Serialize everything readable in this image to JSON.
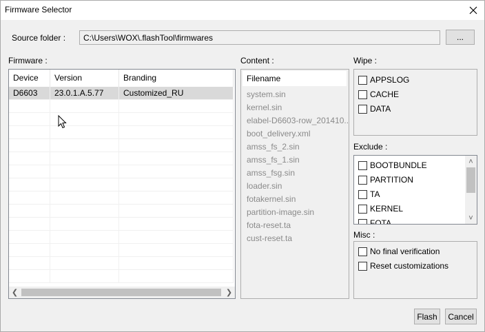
{
  "window": {
    "title": "Firmware Selector"
  },
  "source": {
    "label": "Source folder :",
    "path": "C:\\Users\\WOX\\.flashTool\\firmwares",
    "browse_label": "..."
  },
  "firmware": {
    "label": "Firmware :",
    "columns": [
      "Device",
      "Version",
      "Branding"
    ],
    "rows": [
      {
        "device": "D6603",
        "version": "23.0.1.A.5.77",
        "branding": "Customized_RU"
      }
    ]
  },
  "content": {
    "label": "Content :",
    "header": "Filename",
    "files": [
      "system.sin",
      "kernel.sin",
      "elabel-D6603-row_201410...",
      "boot_delivery.xml",
      "amss_fs_2.sin",
      "amss_fs_1.sin",
      "amss_fsg.sin",
      "loader.sin",
      "fotakernel.sin",
      "partition-image.sin",
      "fota-reset.ta",
      "cust-reset.ta"
    ]
  },
  "wipe": {
    "label": "Wipe :",
    "items": [
      "APPSLOG",
      "CACHE",
      "DATA"
    ]
  },
  "exclude": {
    "label": "Exclude :",
    "items": [
      "BOOTBUNDLE",
      "PARTITION",
      "TA",
      "KERNEL",
      "FOTA"
    ]
  },
  "misc": {
    "label": "Misc :",
    "items": [
      "No final verification",
      "Reset customizations"
    ]
  },
  "actions": {
    "flash_label": "Flash",
    "cancel_label": "Cancel"
  },
  "icons": {
    "close": "close-icon",
    "cursor": "mouse-pointer-icon"
  }
}
